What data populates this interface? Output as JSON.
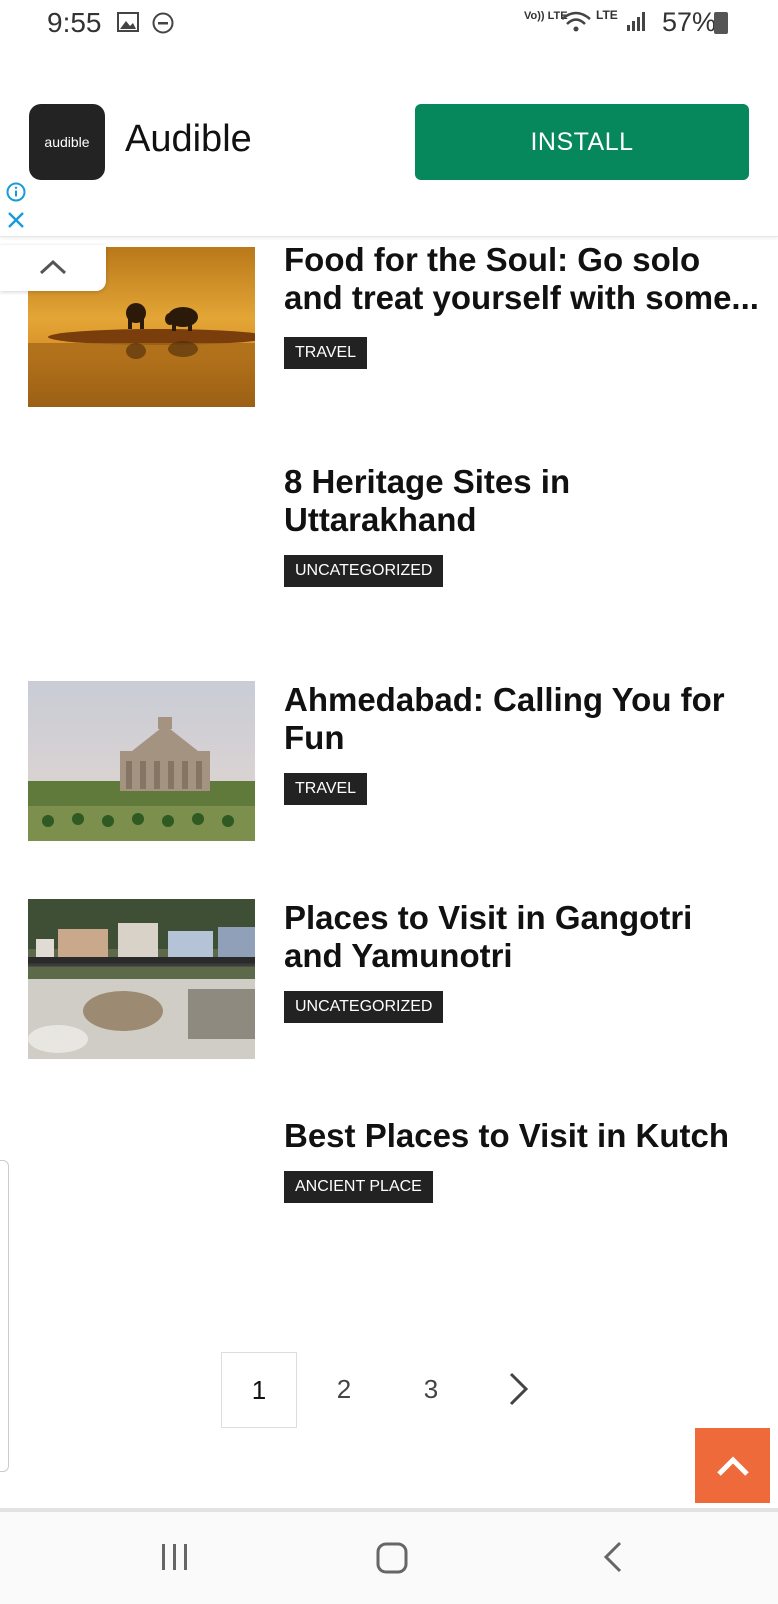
{
  "status_bar": {
    "time": "9:55",
    "volte_label": "Vo)) LTE",
    "lte_label": "LTE",
    "battery_percent": "57%",
    "icons": [
      "image-icon",
      "dnd-icon",
      "wifi-icon",
      "signal-icon",
      "battery-icon"
    ]
  },
  "ad": {
    "app_icon_text": "audible",
    "app_name": "Audible",
    "install_label": "INSTALL",
    "install_color": "#06875c"
  },
  "posts": [
    {
      "title": "Food for the Soul: Go solo and treat yourself with some...",
      "tag": "TRAVEL",
      "has_image": true,
      "image": "elephants-sunset"
    },
    {
      "title": "8 Heritage Sites in Uttarakhand",
      "tag": "UNCATEGORIZED",
      "has_image": false
    },
    {
      "title": "Ahmedabad: Calling You for Fun",
      "tag": "TRAVEL",
      "has_image": true,
      "image": "memorial-garden"
    },
    {
      "title": "Places to Visit in Gangotri and Yamunotri",
      "tag": "UNCATEGORIZED",
      "has_image": true,
      "image": "river-town"
    },
    {
      "title": "Best Places to Visit in Kutch",
      "tag": "ANCIENT PLACE",
      "has_image": false
    }
  ],
  "pagination": {
    "pages": [
      "1",
      "2",
      "3"
    ],
    "current": "1",
    "next_icon": "chevron-right-icon"
  },
  "accent_color": "#ef6a3b"
}
